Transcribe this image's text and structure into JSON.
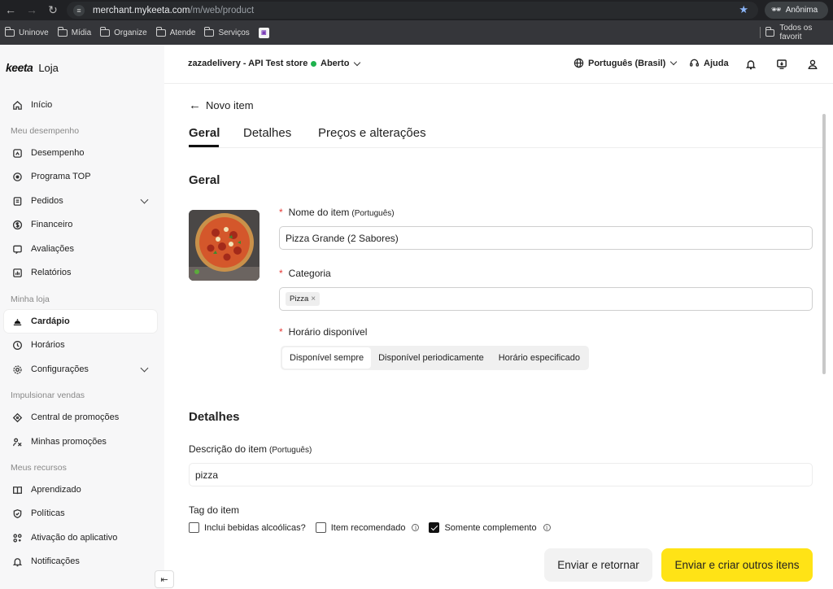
{
  "browser": {
    "url_host": "merchant.mykeeta.com",
    "url_path": "/m/web/product",
    "profile_label": "Anônima",
    "bookmarks": [
      "Uninove",
      "Mídia",
      "Organize",
      "Atende",
      "Serviços"
    ],
    "bookmarks_right": "Todos os favorit"
  },
  "sidebar": {
    "brand": "keeta",
    "brand_suffix": "Loja",
    "items": [
      {
        "label": "Início"
      },
      {
        "section": "Meu desempenho"
      },
      {
        "label": "Desempenho"
      },
      {
        "label": "Programa TOP"
      },
      {
        "label": "Pedidos"
      },
      {
        "label": "Financeiro"
      },
      {
        "label": "Avaliações"
      },
      {
        "label": "Relatórios"
      },
      {
        "section": "Minha loja"
      },
      {
        "label": "Cardápio",
        "active": true
      },
      {
        "label": "Horários"
      },
      {
        "label": "Configurações"
      },
      {
        "section": "Impulsionar vendas"
      },
      {
        "label": "Central de promoções"
      },
      {
        "label": "Minhas promoções"
      },
      {
        "section": "Meus recursos"
      },
      {
        "label": "Aprendizado"
      },
      {
        "label": "Políticas"
      },
      {
        "label": "Ativação do aplicativo"
      },
      {
        "label": "Notificações"
      }
    ]
  },
  "header": {
    "store_name": "zazadelivery - API Test store",
    "status": "Aberto",
    "status_color": "#1fb24e",
    "language": "Português (Brasil)",
    "help": "Ajuda"
  },
  "page": {
    "back_label": "Novo item",
    "tabs": [
      "Geral",
      "Detalhes",
      "Preços e alterações"
    ]
  },
  "geral": {
    "heading": "Geral",
    "name_label": "Nome do item",
    "name_lang": "(Português)",
    "name_value": "Pizza Grande (2 Sabores)",
    "category_label": "Categoria",
    "category_chip": "Pizza",
    "availability_label": "Horário disponível",
    "availability_options": [
      "Disponível sempre",
      "Disponível periodicamente",
      "Horário especificado"
    ],
    "required_mark": "*"
  },
  "detalhes": {
    "heading": "Detalhes",
    "description_label": "Descrição do item",
    "description_lang": "(Português)",
    "description_value": "pizza",
    "tag_label": "Tag do item",
    "tags": [
      {
        "label": "Inclui bebidas alcoólicas?",
        "checked": false
      },
      {
        "label": "Item recomendado",
        "checked": false
      },
      {
        "label": "Somente complemento",
        "checked": true
      }
    ]
  },
  "actions": {
    "secondary": "Enviar e retornar",
    "primary": "Enviar e criar outros itens",
    "primary_color": "#ffe316"
  }
}
